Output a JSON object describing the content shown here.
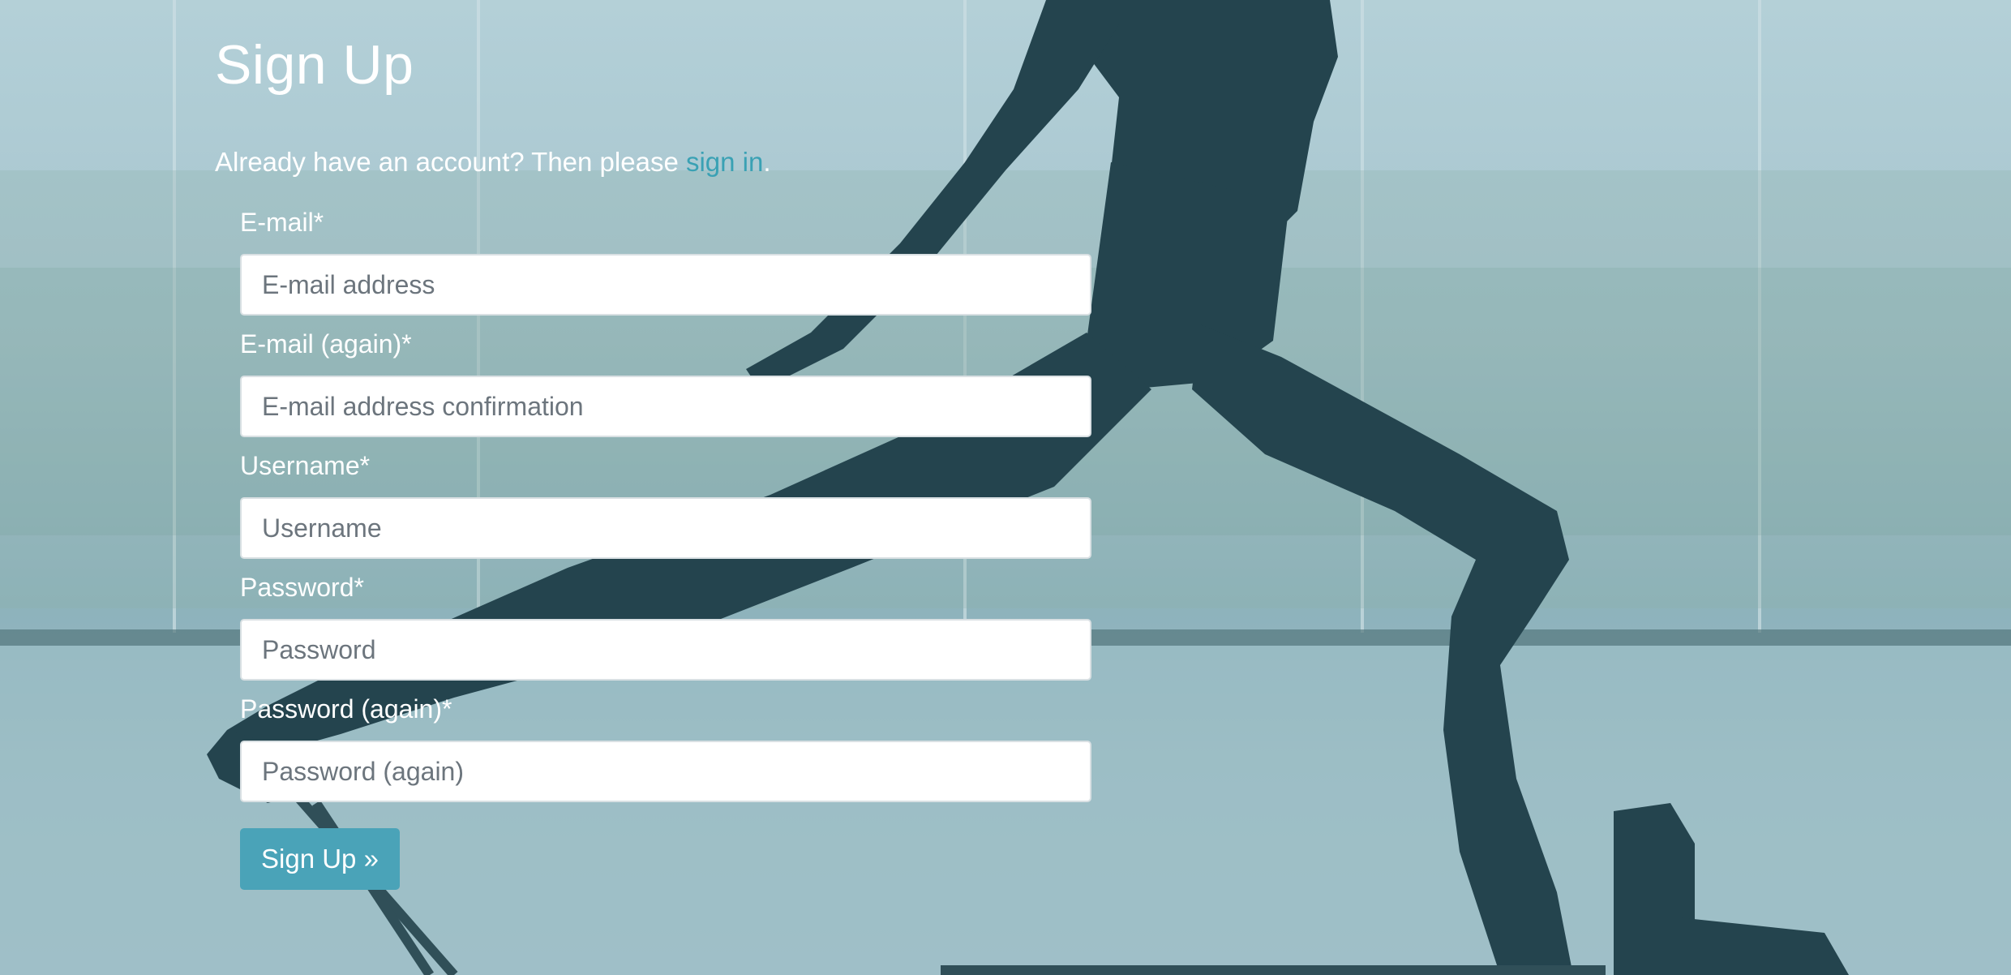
{
  "header": {
    "title": "Sign Up"
  },
  "intro": {
    "prefix": "Already have an account? Then please ",
    "link_text": "sign in",
    "suffix": "."
  },
  "form": {
    "fields": [
      {
        "label": "E-mail*",
        "placeholder": "E-mail address",
        "value": ""
      },
      {
        "label": "E-mail (again)*",
        "placeholder": "E-mail address confirmation",
        "value": ""
      },
      {
        "label": "Username*",
        "placeholder": "Username",
        "value": ""
      },
      {
        "label": "Password*",
        "placeholder": "Password",
        "value": ""
      },
      {
        "label": "Password (again)*",
        "placeholder": "Password (again)",
        "value": ""
      }
    ],
    "submit_label": "Sign Up »"
  },
  "colors": {
    "accent": "#4aa3b8",
    "link": "#3aa1b4",
    "silhouette": "#1d3b45"
  }
}
